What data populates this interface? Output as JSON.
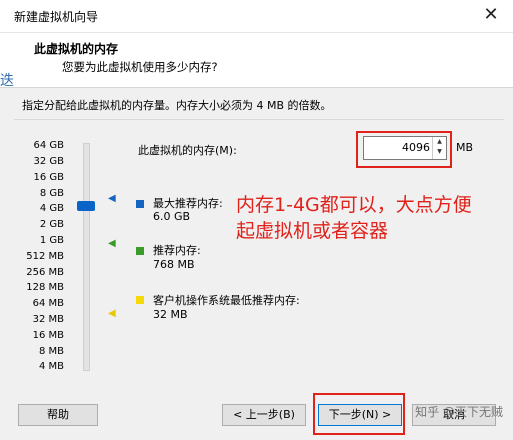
{
  "window": {
    "title": "新建虚拟机向导",
    "close_glyph": "✕"
  },
  "background_fragment": "迭",
  "header": {
    "title": "此虚拟机的内存",
    "subtitle": "您要为此虚拟机使用多少内存?"
  },
  "instruction": "指定分配给此虚拟机的内存量。内存大小必须为 4 MB 的倍数。",
  "scale_ticks": [
    "64 GB",
    "32 GB",
    "16 GB",
    "8 GB",
    "4 GB",
    "2 GB",
    "1 GB",
    "512 MB",
    "256 MB",
    "128 MB",
    "64 MB",
    "32 MB",
    "16 MB",
    "8 MB",
    "4 MB"
  ],
  "memory": {
    "label": "此虚拟机的内存(M):",
    "value": "4096",
    "unit": "MB"
  },
  "legend": [
    {
      "label": "最大推荐内存:",
      "value": "6.0 GB",
      "color": "#1565c0"
    },
    {
      "label": "推荐内存:",
      "value": "768 MB",
      "color": "#3a9a2a"
    },
    {
      "label": "客户机操作系统最低推荐内存:",
      "value": "32 MB",
      "color": "#f5d90a"
    }
  ],
  "annotation": {
    "line1": "内存1-4G都可以，大点方便",
    "line2": "起虚拟机或者容器",
    "color": "#e0221b"
  },
  "buttons": {
    "help": "帮助",
    "back": "< 上一步(B)",
    "next": "下一步(N) >",
    "cancel": "取消"
  },
  "watermark": "知乎 @天下无贼"
}
